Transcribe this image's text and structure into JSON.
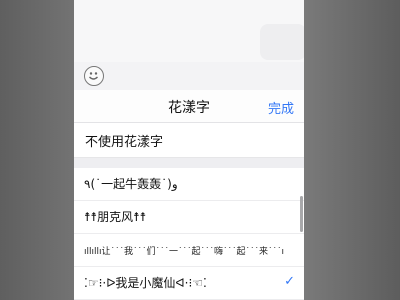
{
  "picker": {
    "title": "花漾字",
    "done_label": "完成",
    "none_option": "不使用花漾字"
  },
  "styles": [
    "٩(˙一起牛轰轰˙)و",
    "☨☨朋克风☨☨",
    "ıllıllı让˙˙˙我˙˙˙们˙˙˙一˙˙˙起˙˙˙嗨˙˙˙起˙˙˙来˙˙˙ıllıllı",
    "⁚☞⁝·ᐅ我是小魔仙ᐊ·⁝☜⁚"
  ],
  "selected_index": 3,
  "check_icon": "✓"
}
